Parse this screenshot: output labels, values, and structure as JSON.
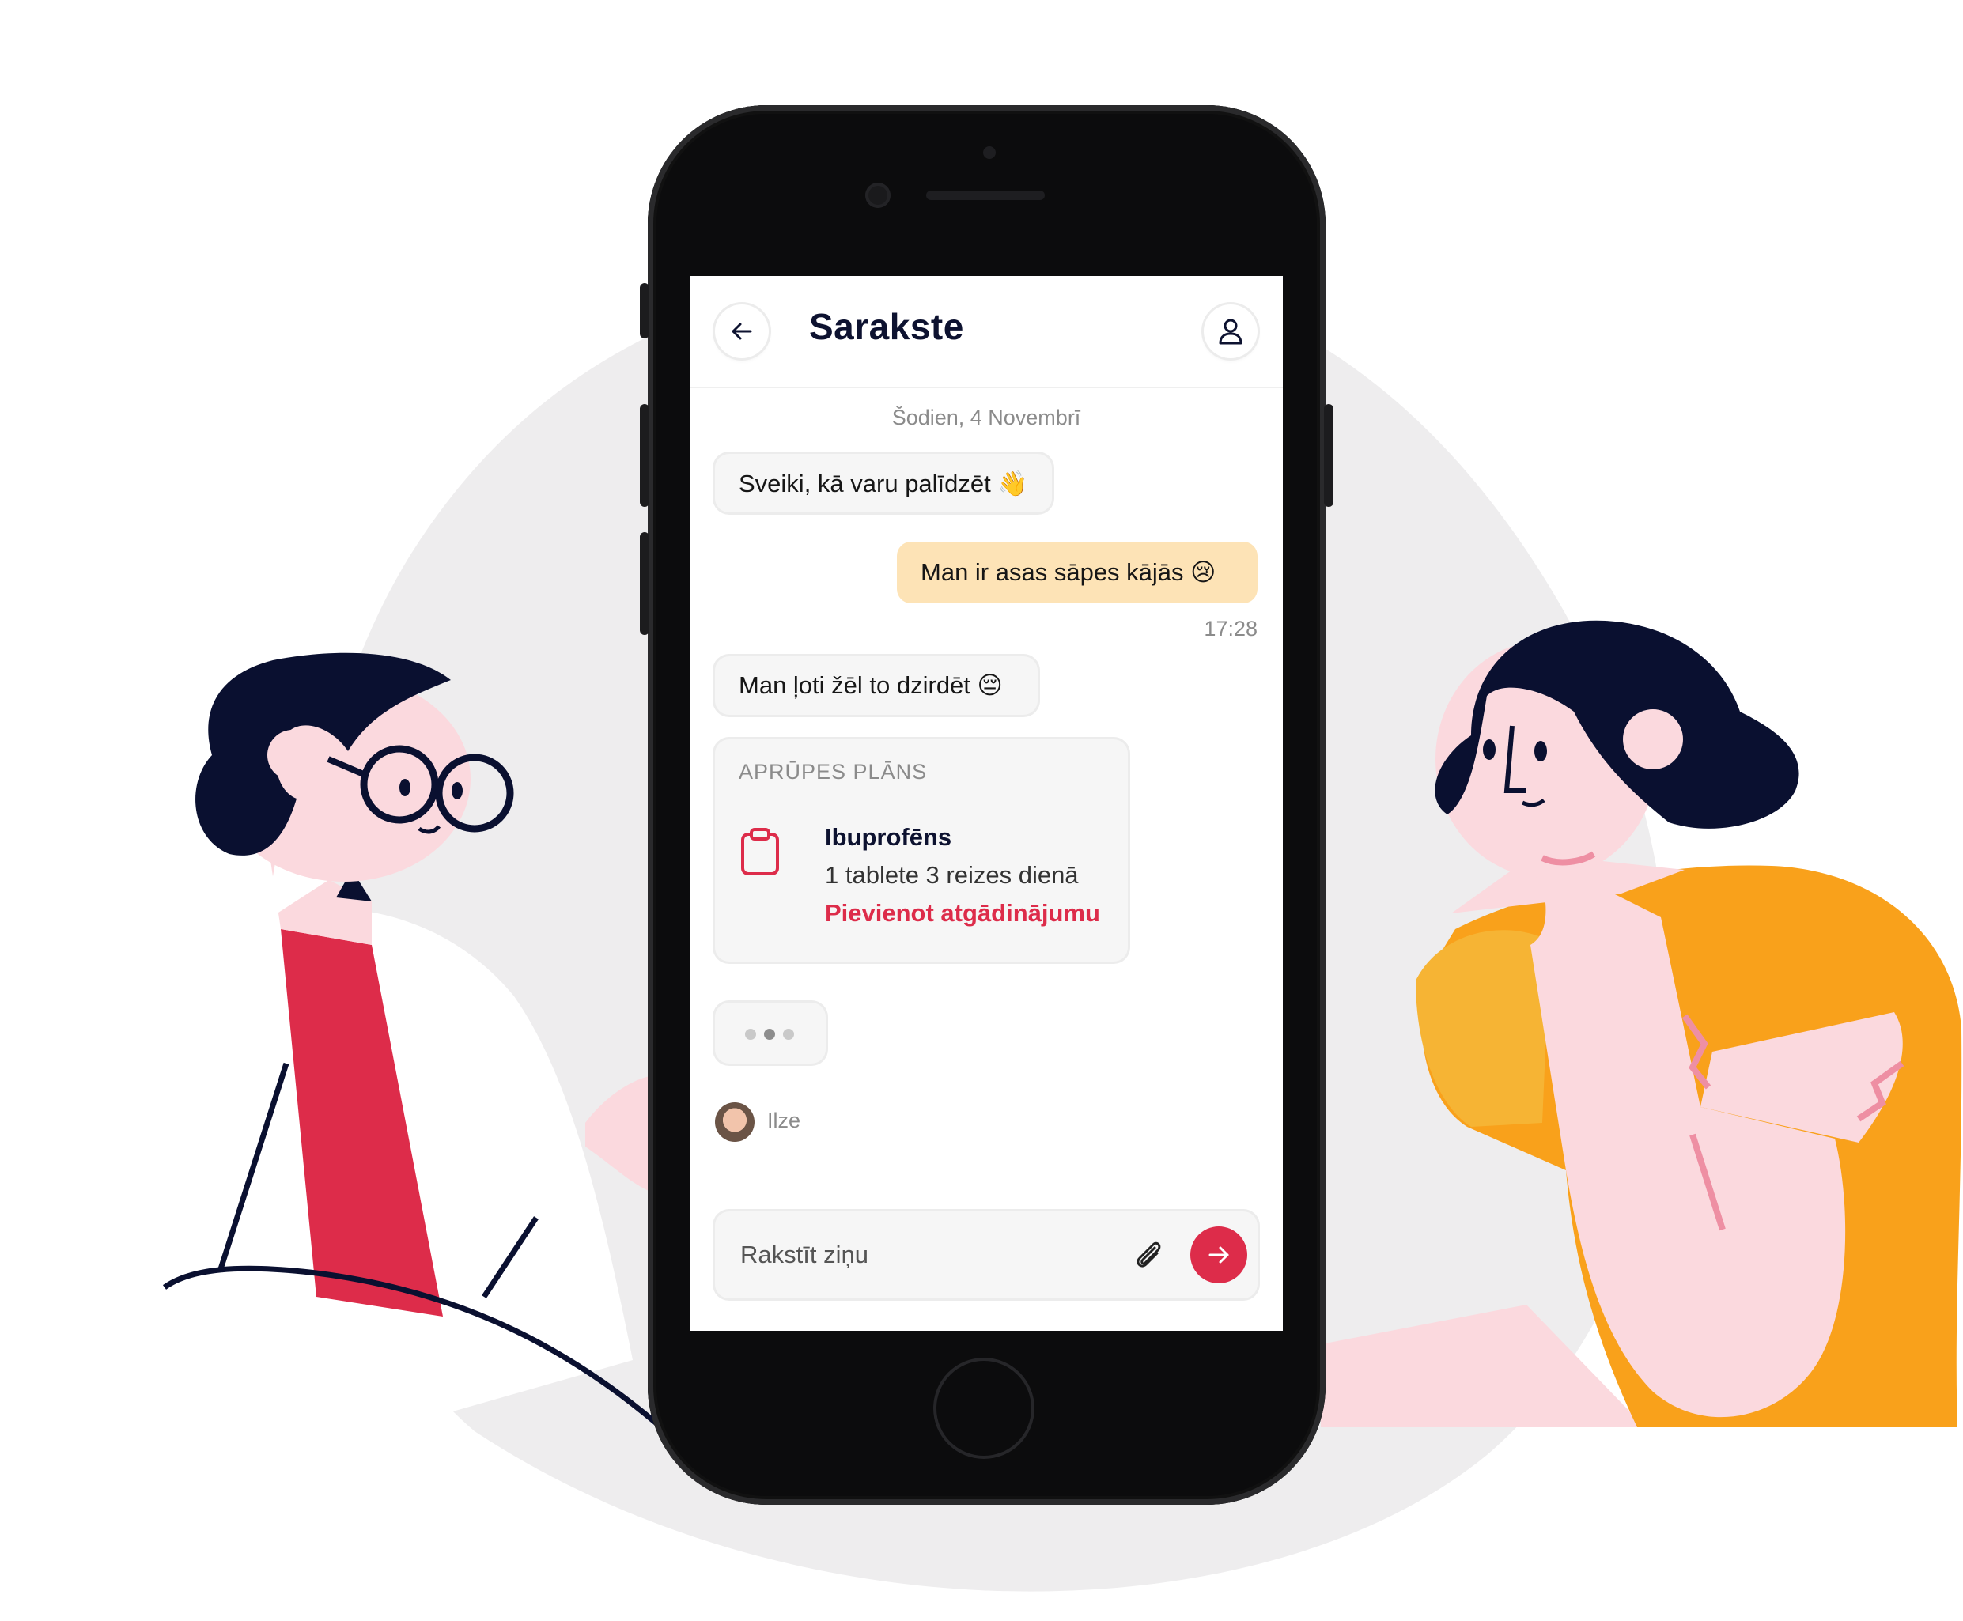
{
  "header": {
    "title": "Sarakste",
    "back_icon": "arrow-left-icon",
    "profile_icon": "user-icon"
  },
  "chat": {
    "date_label": "Šodien, 4 Novembrī",
    "messages": [
      {
        "direction": "incoming",
        "text": "Sveiki, kā varu palīdzēt 👋"
      },
      {
        "direction": "outgoing",
        "text": "Man ir asas sāpes kājās 😢"
      },
      {
        "direction": "incoming",
        "text": "Man ļoti žēl to dzirdēt 😔"
      }
    ],
    "outgoing_time": "17:28",
    "care_plan": {
      "label": "APRŪPES PLĀNS",
      "icon": "clipboard-icon",
      "medicine": "Ibuprofēns",
      "dosage": "1 tablete 3 reizes dienā",
      "action": "Pievienot atgādinājumu"
    },
    "typing_indicator": {
      "author": "Ilze"
    }
  },
  "composer": {
    "placeholder": "Rakstīt ziņu",
    "attach_icon": "paperclip-icon",
    "send_icon": "arrow-right-icon"
  },
  "colors": {
    "accent": "#dd2c4a",
    "outgoing_bubble": "#fde3b6",
    "title": "#0d1230",
    "background_blob": "#eeedee",
    "shirt_yellow": "#f9a11b",
    "skin_pink": "#fbd9de"
  }
}
